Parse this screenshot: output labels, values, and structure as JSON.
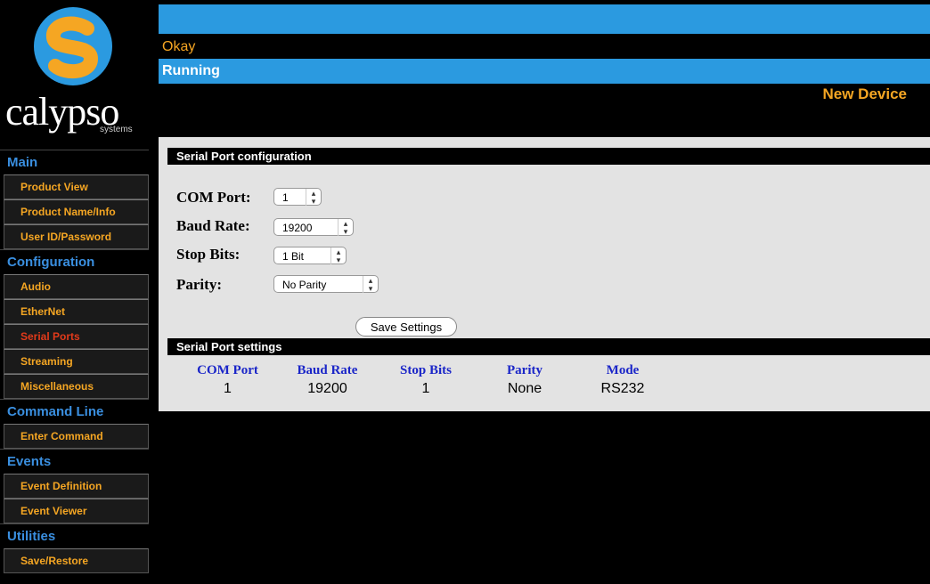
{
  "logo": {
    "word": "calypso",
    "sub": "systems",
    "colors": {
      "outer": "#2b9ae0",
      "inner": "#f5a623"
    }
  },
  "status": {
    "message": "Okay",
    "state": "Running",
    "device_name": "New Device"
  },
  "sidebar": {
    "sections": [
      {
        "label": "Main",
        "items": [
          "Product View",
          "Product Name/Info",
          "User ID/Password"
        ]
      },
      {
        "label": "Configuration",
        "items": [
          "Audio",
          "EtherNet",
          "Serial Ports",
          "Streaming",
          "Miscellaneous"
        ]
      },
      {
        "label": "Command Line",
        "items": [
          "Enter Command"
        ]
      },
      {
        "label": "Events",
        "items": [
          "Event Definition",
          "Event Viewer"
        ]
      },
      {
        "label": "Utilities",
        "items": [
          "Save/Restore"
        ]
      }
    ],
    "active_item": "Serial Ports"
  },
  "config": {
    "title": "Serial Port configuration",
    "com_port": {
      "label": "COM Port:",
      "value": "1"
    },
    "baud_rate": {
      "label": "Baud Rate:",
      "value": "19200"
    },
    "stop_bits": {
      "label": "Stop Bits:",
      "value": "1 Bit"
    },
    "parity": {
      "label": "Parity:",
      "value": "No Parity"
    },
    "save_label": "Save Settings"
  },
  "settings": {
    "title": "Serial Port settings",
    "headers": [
      "COM Port",
      "Baud Rate",
      "Stop Bits",
      "Parity",
      "Mode"
    ],
    "row": [
      "1",
      "19200",
      "1",
      "None",
      "RS232"
    ]
  }
}
